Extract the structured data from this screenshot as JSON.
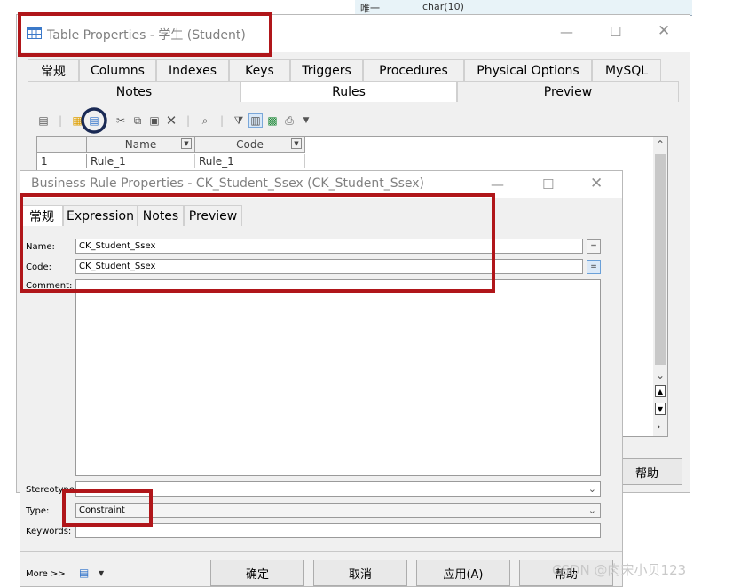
{
  "background_snippet": {
    "text1": "唯一",
    "text2": "char(10)"
  },
  "table_properties": {
    "title": "Table Properties - 学生 (Student)",
    "tabs_row1": [
      "常规",
      "Columns",
      "Indexes",
      "Keys",
      "Triggers",
      "Procedures",
      "Physical Options",
      "MySQL"
    ],
    "tabs_row2": [
      "Notes",
      "Rules",
      "Preview"
    ],
    "active_tab": "Rules",
    "grid": {
      "columns": [
        "Name",
        "Code"
      ],
      "rows": [
        {
          "num": "1",
          "name": "Rule_1",
          "code": "Rule_1"
        }
      ]
    },
    "help_button": "帮助"
  },
  "business_rule": {
    "title": "Business Rule Properties - CK_Student_Ssex (CK_Student_Ssex)",
    "tabs": [
      "常规",
      "Expression",
      "Notes",
      "Preview"
    ],
    "active_tab": "常规",
    "labels": {
      "name": "Name:",
      "code": "Code:",
      "comment": "Comment:",
      "stereotype": "Stereotype:",
      "type": "Type:",
      "keywords": "Keywords:"
    },
    "values": {
      "name": "CK_Student_Ssex",
      "code": "CK_Student_Ssex",
      "comment": "",
      "stereotype": "",
      "type": "Constraint",
      "keywords": ""
    },
    "eq_symbol": "=",
    "buttons": {
      "more": "More >>",
      "ok": "确定",
      "cancel": "取消",
      "apply": "应用(A)",
      "help": "帮助"
    }
  },
  "watermark": "CSDN @肉宋小贝123",
  "colors": {
    "highlight": "#b0161a",
    "circle": "#1a2a55",
    "accent": "#2a6fc9"
  }
}
